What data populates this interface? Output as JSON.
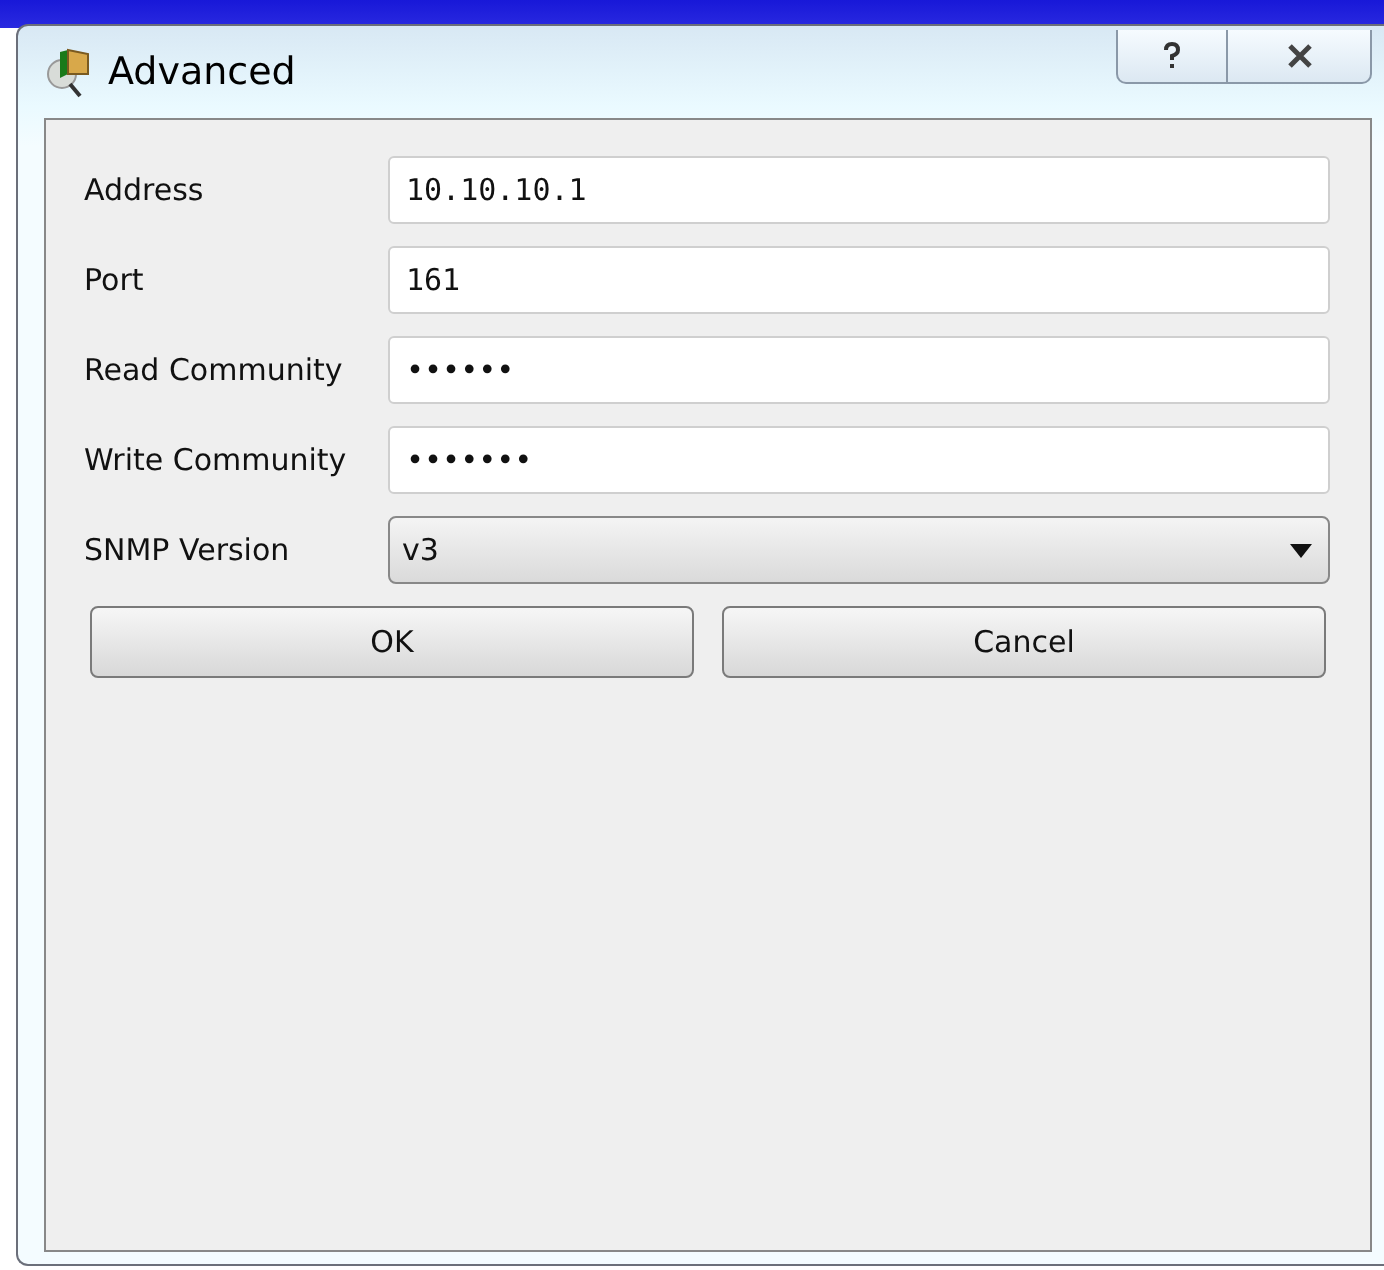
{
  "window": {
    "title": "Advanced"
  },
  "fields": [
    {
      "kind": "text",
      "label": "Address",
      "value": "10.10.10.1"
    },
    {
      "kind": "text",
      "label": "Port",
      "value": "161"
    },
    {
      "kind": "text",
      "label": "Read Community",
      "value": "••••••"
    },
    {
      "kind": "text",
      "label": "Write Community",
      "value": "•••••••"
    },
    {
      "kind": "dropdown",
      "label": "SNMP Version",
      "value": "v3"
    }
  ],
  "buttons": [
    "OK",
    "Cancel"
  ]
}
